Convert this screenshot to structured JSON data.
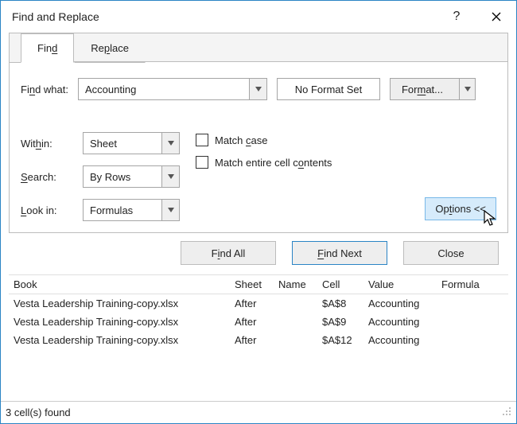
{
  "title": "Find and Replace",
  "tabs": {
    "find": "Find",
    "replace": "Replace"
  },
  "findWhat": {
    "label": "Find what:",
    "value": "Accounting"
  },
  "format": {
    "status": "No Format Set",
    "button": "Format..."
  },
  "within": {
    "label": "Within:",
    "value": "Sheet"
  },
  "search": {
    "label": "Search:",
    "value": "By Rows"
  },
  "lookin": {
    "label": "Look in:",
    "value": "Formulas"
  },
  "matchCase": "Match case",
  "matchEntire": "Match entire cell contents",
  "optionsBtn": "Options <<",
  "buttons": {
    "findAll": "Find All",
    "findNext": "Find Next",
    "close": "Close"
  },
  "columns": {
    "book": "Book",
    "sheet": "Sheet",
    "name": "Name",
    "cell": "Cell",
    "value": "Value",
    "formula": "Formula"
  },
  "rows": [
    {
      "book": "Vesta Leadership Training-copy.xlsx",
      "sheet": "After",
      "name": "",
      "cell": "$A$8",
      "value": "Accounting",
      "formula": ""
    },
    {
      "book": "Vesta Leadership Training-copy.xlsx",
      "sheet": "After",
      "name": "",
      "cell": "$A$9",
      "value": "Accounting",
      "formula": ""
    },
    {
      "book": "Vesta Leadership Training-copy.xlsx",
      "sheet": "After",
      "name": "",
      "cell": "$A$12",
      "value": "Accounting",
      "formula": ""
    }
  ],
  "status": "3 cell(s) found"
}
